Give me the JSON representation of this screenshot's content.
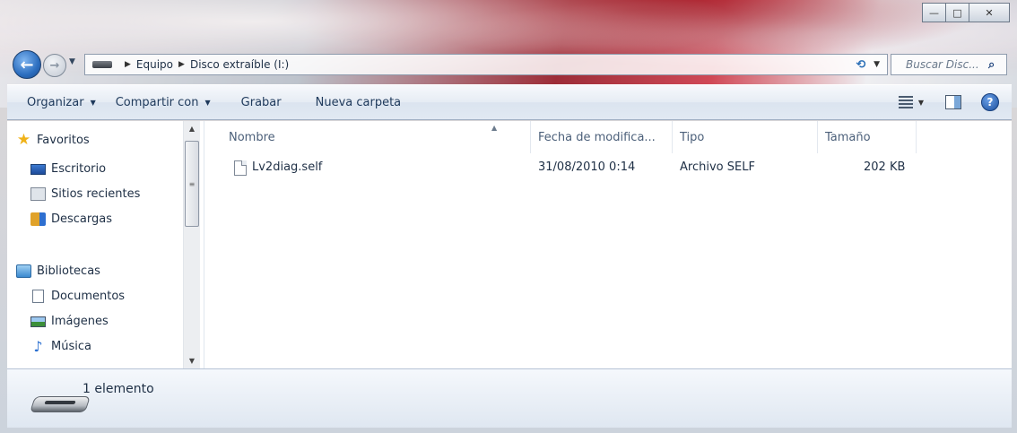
{
  "window": {
    "caption_buttons": {
      "minimize": "—",
      "maximize": "□",
      "close": "✕"
    }
  },
  "address_bar": {
    "crumbs": [
      "Equipo",
      "Disco extraíble (I:)"
    ]
  },
  "search": {
    "placeholder": "Buscar Disc..."
  },
  "toolbar": {
    "organize": "Organizar",
    "share": "Compartir con",
    "burn": "Grabar",
    "new_folder": "Nueva carpeta"
  },
  "nav_pane": {
    "favorites": "Favoritos",
    "favorites_items": [
      "Escritorio",
      "Sitios recientes",
      "Descargas"
    ],
    "libraries": "Bibliotecas",
    "library_items": [
      "Documentos",
      "Imágenes",
      "Música"
    ]
  },
  "columns": {
    "name": "Nombre",
    "modified": "Fecha de modifica...",
    "type": "Tipo",
    "size": "Tamaño"
  },
  "files": [
    {
      "name": "Lv2diag.self",
      "modified": "31/08/2010 0:14",
      "type": "Archivo SELF",
      "size": "202 KB"
    }
  ],
  "status": {
    "item_count": "1 elemento"
  },
  "icons": {
    "back": "back-arrow-icon",
    "forward": "forward-arrow-icon",
    "search": "search-icon",
    "favorites": "star-icon",
    "help": "help-icon"
  }
}
